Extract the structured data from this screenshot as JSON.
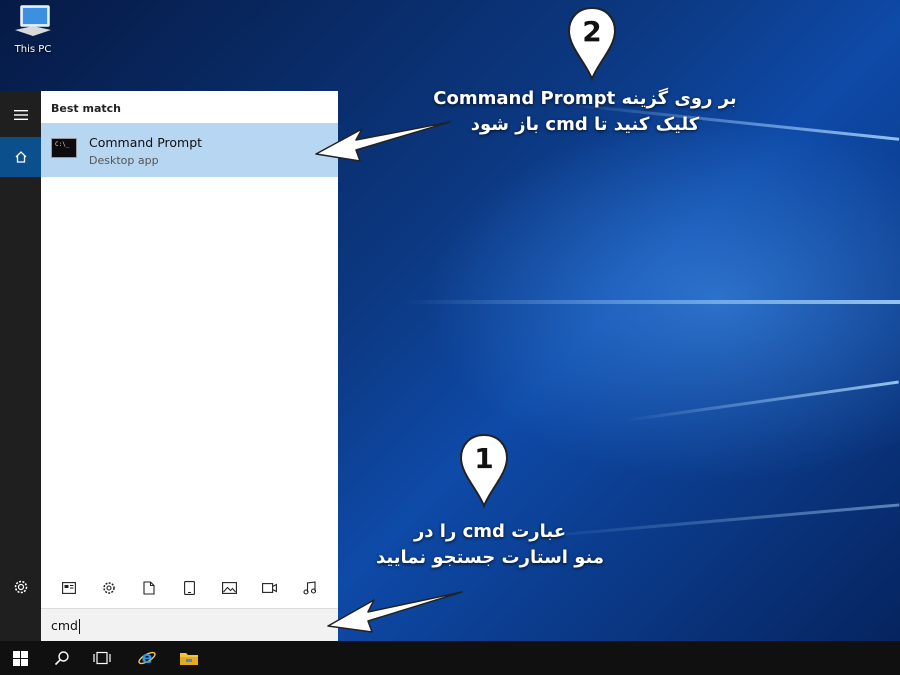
{
  "desktop": {
    "icon_label": "This PC"
  },
  "start_menu": {
    "section_header": "Best match",
    "best_match": {
      "title": "Command Prompt",
      "subtitle": "Desktop app",
      "icon_text": "C:\\_"
    },
    "filters": [
      "apps-icon",
      "settings-icon",
      "documents-icon",
      "tablet-icon",
      "photos-icon",
      "videos-icon",
      "music-icon"
    ],
    "search_value": "cmd",
    "rail_icons": [
      "hamburger-icon",
      "home-icon",
      "gear-icon"
    ]
  },
  "taskbar": {
    "items": [
      "windows-start-icon",
      "search-icon",
      "task-view-icon",
      "internet-explorer-icon",
      "file-explorer-icon"
    ]
  },
  "annotations": {
    "step1": {
      "number": "1",
      "line1": "عبارت cmd را در",
      "line2": "منو استارت جستجو نمایید"
    },
    "step2": {
      "number": "2",
      "line1": "بر روی گزینه Command Prompt",
      "line2": "کلیک کنید تا cmd باز شود"
    }
  },
  "colors": {
    "highlight": "#b7d6f1",
    "rail": "#1f1f1f",
    "rail_active": "#0b4f8c",
    "taskbar": "#101010"
  }
}
